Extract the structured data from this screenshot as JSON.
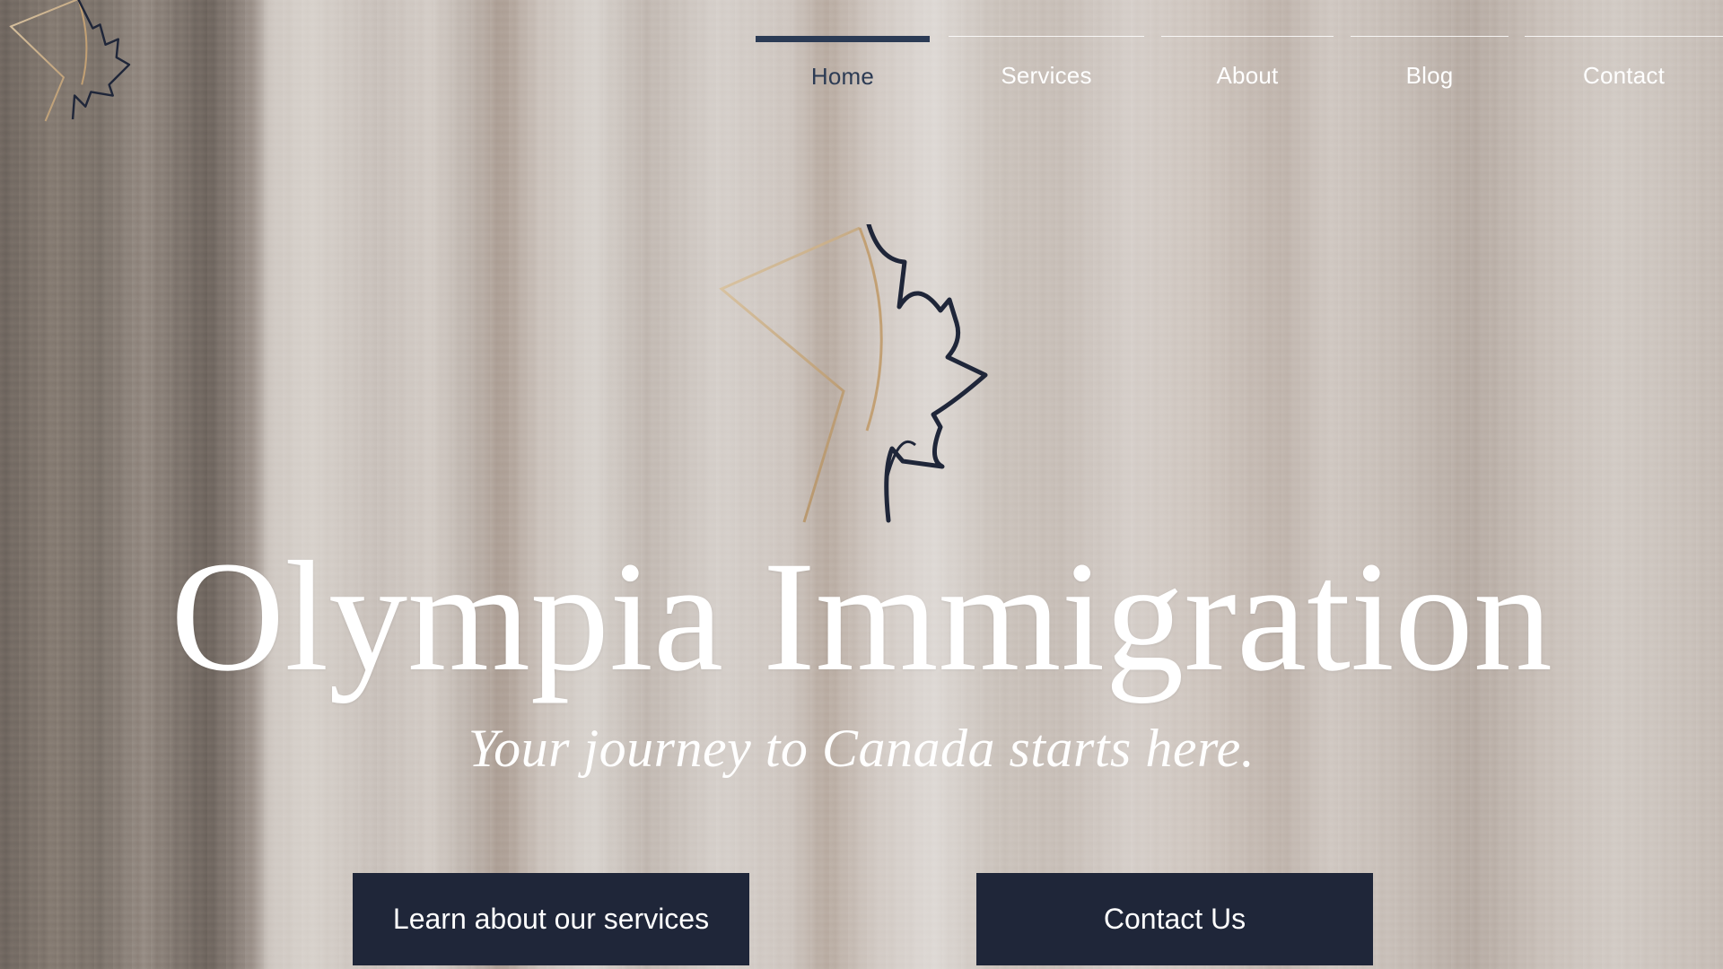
{
  "brand": {
    "title": "Olympia Immigration",
    "tagline": "Your journey to Canada starts here.",
    "logo_icon": "maple-leaf-logo-icon",
    "colors": {
      "navy": "#1f2639",
      "gold": "#c2a074",
      "white": "#ffffff"
    }
  },
  "nav": {
    "items": [
      {
        "label": "Home",
        "active": true
      },
      {
        "label": "Services",
        "active": false
      },
      {
        "label": "About",
        "active": false
      },
      {
        "label": "Blog",
        "active": false
      },
      {
        "label": "Contact",
        "active": false
      }
    ]
  },
  "cta": {
    "services_label": "Learn about our services",
    "contact_label": "Contact Us"
  }
}
